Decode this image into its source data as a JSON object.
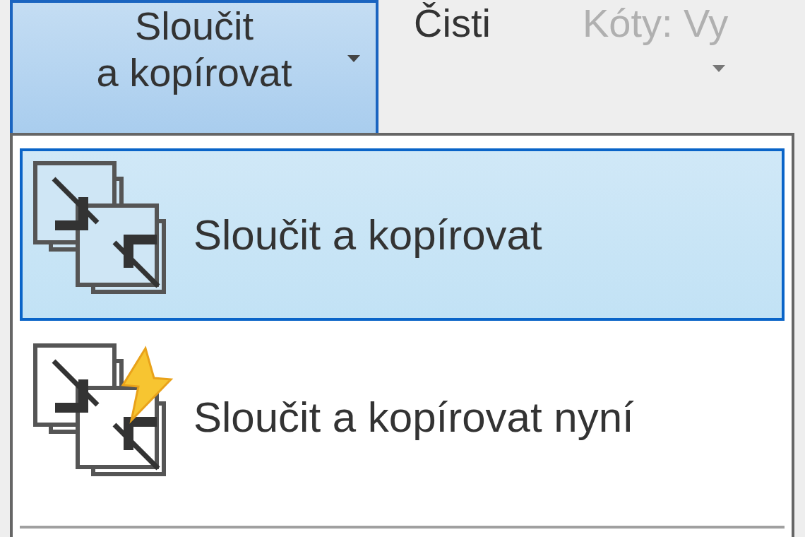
{
  "ribbon": {
    "buttons": [
      {
        "kind": "split",
        "label_lines": [
          "Sloučit",
          "a kopírovat"
        ],
        "selected": true,
        "disabled": false
      },
      {
        "kind": "plain",
        "label_lines": [
          "Čisti"
        ],
        "selected": false,
        "disabled": false
      },
      {
        "kind": "dropdown",
        "label_lines": [
          "Kóty: Vy"
        ],
        "selected": false,
        "disabled": true
      }
    ]
  },
  "menu": {
    "items": [
      {
        "kind": "merge",
        "label": "Sloučit a kopírovat",
        "selected": true
      },
      {
        "kind": "merge-now",
        "label": "Sloučit a kopírovat nyní",
        "selected": false
      }
    ]
  }
}
